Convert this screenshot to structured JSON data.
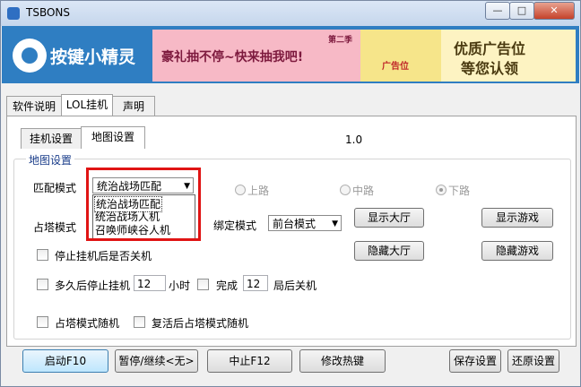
{
  "window": {
    "title": "TSBONS",
    "controls": {
      "minimize": "—",
      "maximize": "□",
      "close": "✕"
    }
  },
  "banner": {
    "logo_text": "按键小精灵",
    "ad_left_text": "豪礼抽不停~快来抽我吧!",
    "ad_left_badge": "第二季",
    "ad_mid_text": "广告位",
    "ad_right_line1": "优质广告位",
    "ad_right_line2": "等您认领"
  },
  "top_tabs": [
    "软件说明",
    "LOL挂机",
    "声明"
  ],
  "sub_tabs": [
    "挂机设置",
    "地图设置"
  ],
  "version": "1.0",
  "map_settings": {
    "group_title": "地图设置",
    "match_mode_label": "匹配模式",
    "match_mode_value": "统治战场匹配",
    "match_mode_options": [
      "统治战场匹配",
      "统治战场人机",
      "召唤师峡谷人机"
    ],
    "tower_mode_label": "占塔模式",
    "lanes": [
      "上路",
      "中路",
      "下路"
    ],
    "selected_lane": "下路",
    "bind_mode_label": "绑定模式",
    "bind_mode_value": "前台模式"
  },
  "side_buttons": {
    "show_lobby": "显示大厅",
    "hide_lobby": "隐藏大厅",
    "show_game": "显示游戏",
    "hide_game": "隐藏游戏"
  },
  "options": {
    "shutdown_on_stop": "停止挂机后是否关机",
    "stop_after_prefix": "多久后停止挂机",
    "stop_after_value": "12",
    "stop_after_unit": "小时",
    "finish_prefix": "完成",
    "finish_value": "12",
    "finish_suffix": "局后关机",
    "tower_random": "占塔模式随机",
    "revive_tower_random": "复活后占塔模式随机"
  },
  "bottom_buttons": {
    "start": "启动F10",
    "pause": "暂停/继续<无>",
    "stop": "中止F12",
    "hotkey": "修改热键",
    "save": "保存设置",
    "restore": "还原设置"
  }
}
